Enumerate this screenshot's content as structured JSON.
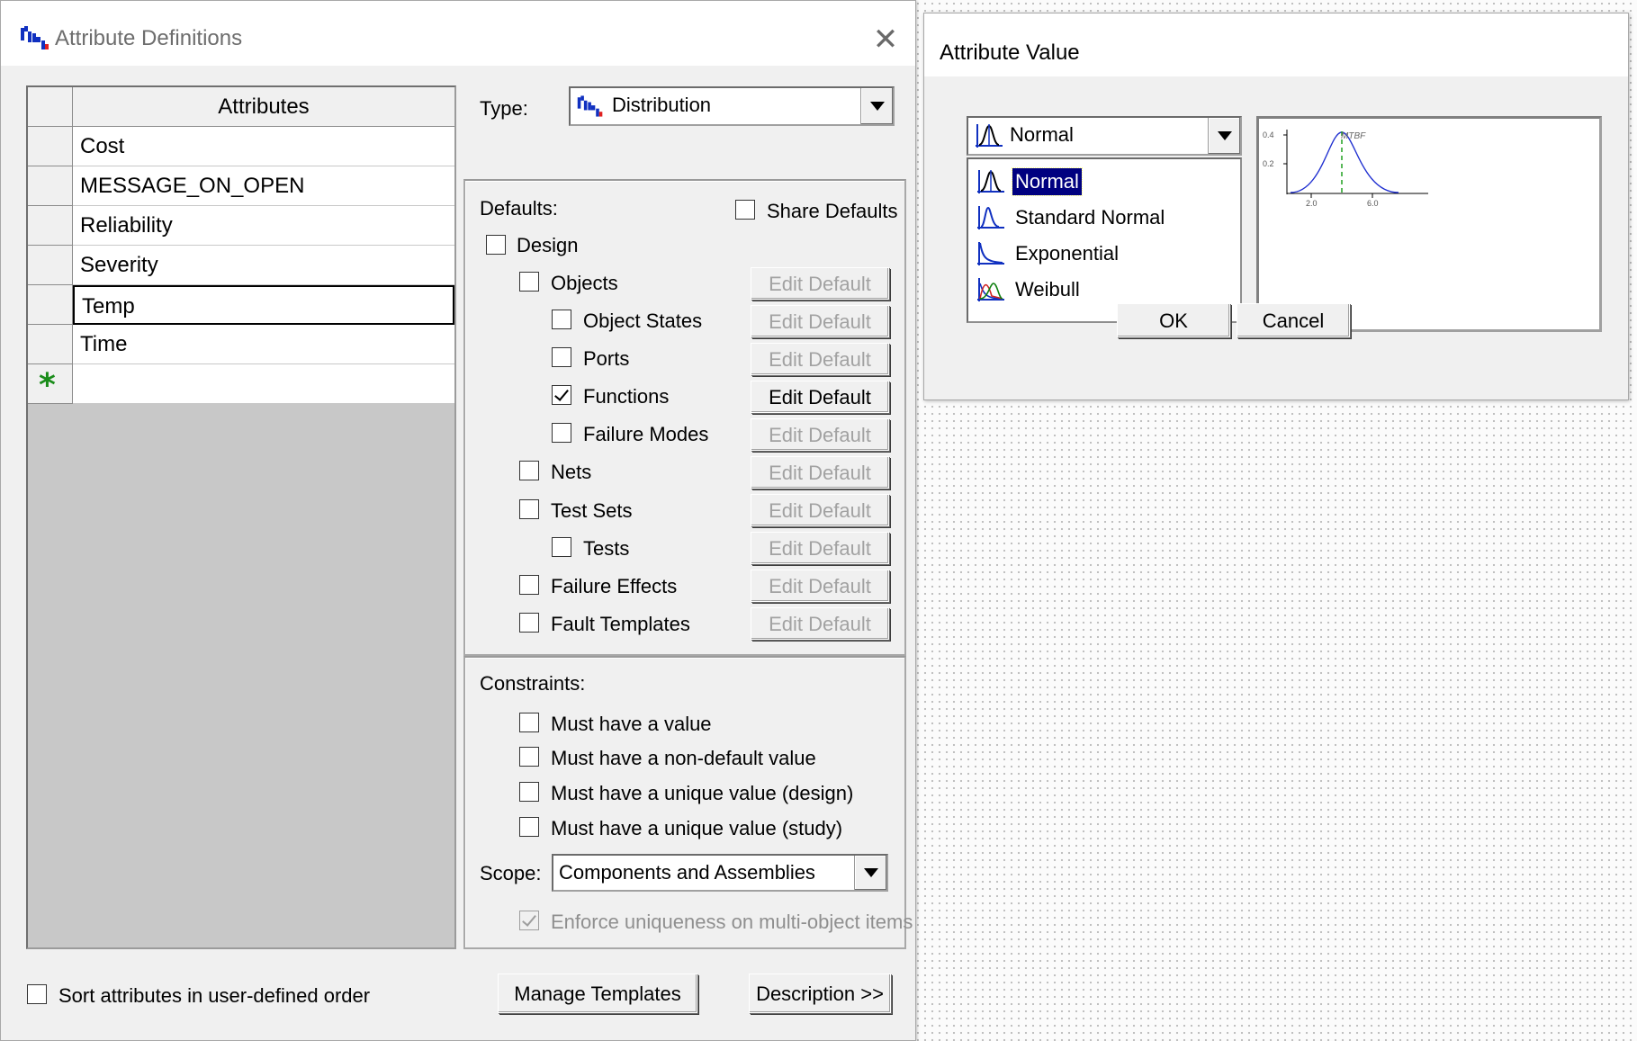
{
  "attr_defs": {
    "title": "Attribute Definitions",
    "close_label": "✕",
    "grid": {
      "header": "Attributes",
      "rows": [
        "Cost",
        "MESSAGE_ON_OPEN",
        "Reliability",
        "Severity",
        "Temp",
        "Time"
      ],
      "active_row": "Temp",
      "new_row_marker": "*"
    },
    "type_label": "Type:",
    "type_value": "Distribution",
    "defaults": {
      "label": "Defaults:",
      "share_defaults": {
        "label": "Share Defaults",
        "checked": false
      },
      "items": [
        {
          "label": "Design",
          "checked": false,
          "button": null
        },
        {
          "label": "Objects",
          "checked": false,
          "button": "Edit Default",
          "enabled": false
        },
        {
          "label": "Object States",
          "checked": false,
          "button": "Edit Default",
          "enabled": false
        },
        {
          "label": "Ports",
          "checked": false,
          "button": "Edit Default",
          "enabled": false
        },
        {
          "label": "Functions",
          "checked": true,
          "button": "Edit Default",
          "enabled": true
        },
        {
          "label": "Failure Modes",
          "checked": false,
          "button": "Edit Default",
          "enabled": false
        },
        {
          "label": "Nets",
          "checked": false,
          "button": "Edit Default",
          "enabled": false
        },
        {
          "label": "Test Sets",
          "checked": false,
          "button": "Edit Default",
          "enabled": false
        },
        {
          "label": "Tests",
          "checked": false,
          "button": "Edit Default",
          "enabled": false
        },
        {
          "label": "Failure Effects",
          "checked": false,
          "button": "Edit Default",
          "enabled": false
        },
        {
          "label": "Fault Templates",
          "checked": false,
          "button": "Edit Default",
          "enabled": false
        }
      ]
    },
    "constraints": {
      "label": "Constraints:",
      "items": [
        {
          "label": "Must have a value",
          "checked": false
        },
        {
          "label": "Must have a non-default value",
          "checked": false
        },
        {
          "label": "Must have a unique value (design)",
          "checked": false
        },
        {
          "label": "Must have a unique value (study)",
          "checked": false
        }
      ],
      "scope_label": "Scope:",
      "scope_value": "Components and Assemblies",
      "enforce": {
        "label": "Enforce uniqueness on multi-object items",
        "checked": true,
        "enabled": false
      }
    },
    "sort_label": "Sort attributes in user-defined order",
    "manage_templates": "Manage Templates",
    "description": "Description >>"
  },
  "attr_value": {
    "title": "Attribute Value",
    "selected": "Normal",
    "options": [
      {
        "label": "Normal",
        "icon": "normal-dist-icon"
      },
      {
        "label": "Standard Normal",
        "icon": "standard-normal-icon"
      },
      {
        "label": "Exponential",
        "icon": "exponential-icon"
      },
      {
        "label": "Weibull",
        "icon": "weibull-icon"
      }
    ],
    "preview": {
      "y_ticks": [
        "0.4",
        "0.2"
      ],
      "x_ticks": [
        "2.0",
        "6.0"
      ],
      "marker": "MTBF"
    },
    "ok": "OK",
    "cancel": "Cancel"
  }
}
